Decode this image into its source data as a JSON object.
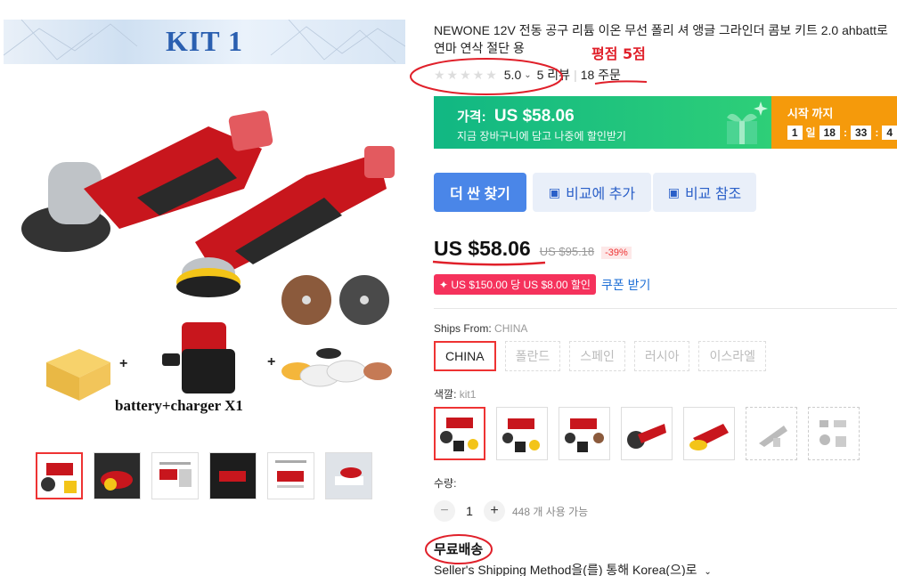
{
  "gallery": {
    "banner_text": "KIT 1",
    "caption": "battery+charger X1",
    "thumb_count": 6
  },
  "product": {
    "title": "NEWONE 12V 전동 공구 리튬 이온 무선 폴리 셔 앵글 그라인더 콤보 키트 2.0 ahbatt로 연마 연삭 절단 용",
    "rating": "5.0",
    "reviews": "5 리뷰",
    "orders": "18 주문"
  },
  "annotations": {
    "rating_note": "평점 5점"
  },
  "promo": {
    "price_label": "가격:",
    "price": "US $58.06",
    "subtitle": "지금 장바구니에 담고 나중에 할인받기",
    "timer_label": "시작 까지",
    "days": "1",
    "day_unit": "일",
    "hours": "18",
    "minutes": "33",
    "seconds": "4"
  },
  "actions": {
    "cheaper": "더 싼 찾기",
    "add_compare": "비교에 추가",
    "view_compare": "비교 참조"
  },
  "pricing": {
    "current": "US $58.06",
    "original": "US $95.18",
    "discount": "-39%",
    "coupon": "US $150.00 당 US $8.00 할인",
    "coupon_link": "쿠폰 받기"
  },
  "shipping_from": {
    "label": "Ships From:",
    "value": "CHINA",
    "options": [
      "CHINA",
      "폴란드",
      "스페인",
      "러시아",
      "이스라엘"
    ]
  },
  "color": {
    "label": "색깔:",
    "value": "kit1"
  },
  "quantity": {
    "label": "수량:",
    "value": "1",
    "available": "448 개 사용 가능"
  },
  "delivery": {
    "free_shipping": "무료배송",
    "method": "Seller's Shipping Method을(를) 통해 Korea(으)로"
  },
  "colors": {
    "accent_red": "#e33333",
    "promo_green": "#1fc07f",
    "promo_orange": "#f59a0b",
    "link_blue": "#1e6fd6",
    "button_blue": "#4a86e8"
  }
}
